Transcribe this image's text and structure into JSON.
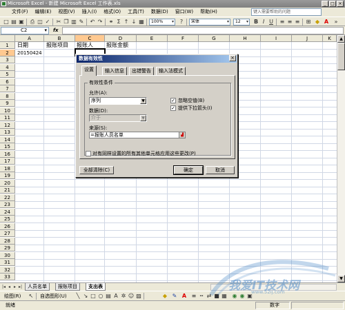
{
  "window": {
    "title": "Microsoft Excel - 新建 Microsoft Excel 工作表.xls"
  },
  "menu": {
    "items": [
      "文件(F)",
      "编辑(E)",
      "视图(V)",
      "插入(I)",
      "格式(O)",
      "工具(T)",
      "数据(D)",
      "窗口(W)",
      "帮助(H)"
    ],
    "help_placeholder": "键入需要帮助的问题"
  },
  "toolbar": {
    "font_size": "12",
    "zoom": "Σ"
  },
  "formula_bar": {
    "name_box": "C2",
    "fx": "fx",
    "content": ""
  },
  "grid": {
    "columns": [
      "A",
      "B",
      "C",
      "D",
      "E",
      "F",
      "G",
      "H",
      "I",
      "J",
      "K"
    ],
    "selected_column": "C",
    "rows": [
      "1",
      "2",
      "3",
      "4",
      "5",
      "6",
      "7",
      "8",
      "9",
      "10",
      "11",
      "12",
      "13",
      "14",
      "15",
      "16",
      "17",
      "18",
      "19",
      "20",
      "21",
      "22",
      "23",
      "24",
      "25",
      "26",
      "27",
      "28",
      "29",
      "30",
      "31",
      "32",
      "33"
    ],
    "selected_row": "2",
    "cells": {
      "A1": "日期",
      "B1": "报账项目",
      "C1": "报账人",
      "D1": "报账金额",
      "A2": "20150424"
    }
  },
  "dialog": {
    "title": "数据有效性",
    "close": "×",
    "tabs": [
      "设置",
      "输入信息",
      "出错警告",
      "输入法模式"
    ],
    "active_tab": "设置",
    "group_label": "有效性条件",
    "allow_label": "允许(A):",
    "allow_value": "序列",
    "data_label": "数据(D):",
    "data_value": "介于",
    "ignore_blank": {
      "label": "忽略空值(B)",
      "checked": "✓"
    },
    "dropdown": {
      "label": "提供下拉箭头(I)",
      "checked": "✓"
    },
    "source_label": "来源(S):",
    "source_value": "=报账人员名单",
    "apply_all": "对有同样设置的所有其他单元格应用这些更改(P)",
    "clear_all": "全部清除(C)",
    "ok": "确定",
    "cancel": "取消"
  },
  "sheets": {
    "tabs": [
      "人员名单",
      "报账项目",
      "支出表"
    ],
    "active": "支出表"
  },
  "drawing": {
    "draw_label": "绘图(R)",
    "autoshape_label": "自选图形(U)"
  },
  "status": {
    "mode": "就绪",
    "num": "数字"
  },
  "watermark": {
    "text": "我爱IT技术网",
    "url": "www.52ij.com"
  }
}
